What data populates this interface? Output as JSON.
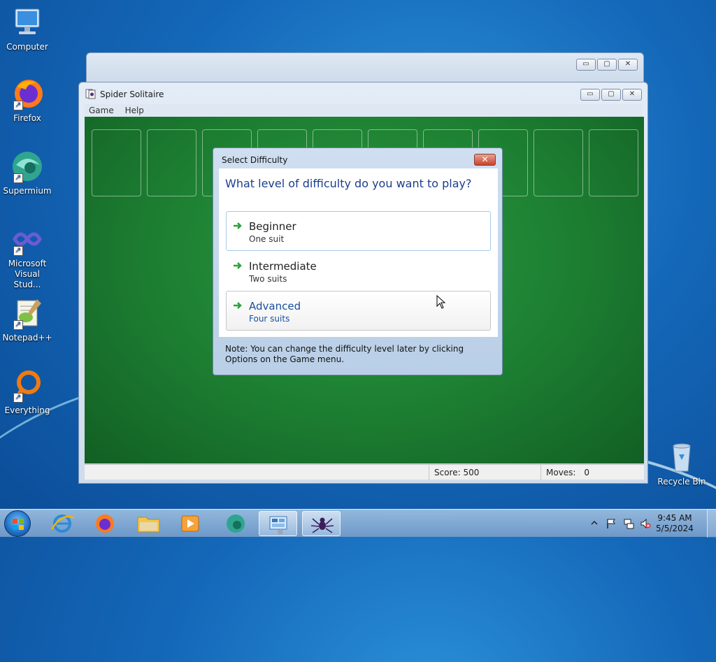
{
  "desktop": {
    "icons": [
      {
        "label": "Computer",
        "icon": "computer-icon"
      },
      {
        "label": "Firefox",
        "icon": "firefox-icon"
      },
      {
        "label": "Supermium",
        "icon": "supermium-icon"
      },
      {
        "label": "Microsoft Visual Stud...",
        "icon": "visual-studio-icon"
      },
      {
        "label": "Notepad++",
        "icon": "notepadpp-icon"
      },
      {
        "label": "Everything",
        "icon": "everything-icon"
      }
    ],
    "recycle_bin": {
      "label": "Recycle Bin",
      "icon": "recycle-bin-icon"
    }
  },
  "window": {
    "title": "Spider Solitaire",
    "menu": [
      "Game",
      "Help"
    ],
    "controls": {
      "minimize": "▭",
      "maximize": "▢",
      "close": "✕"
    },
    "status": {
      "score": "Score: 500",
      "moves_label": "Moves:",
      "moves_value": "0"
    },
    "tableau_slots": 10
  },
  "dialog": {
    "title": "Select Difficulty",
    "close": "✕",
    "question": "What level of difficulty do you want to play?",
    "options": [
      {
        "label": "Beginner",
        "sub": "One suit",
        "state": "selected"
      },
      {
        "label": "Intermediate",
        "sub": "Two suits",
        "state": "normal"
      },
      {
        "label": "Advanced",
        "sub": "Four suits",
        "state": "hover"
      }
    ],
    "note": "Note: You can change the difficulty level later by clicking Options on the Game menu."
  },
  "taskbar": {
    "items": [
      {
        "name": "internet-explorer-icon",
        "active": false
      },
      {
        "name": "firefox-icon",
        "active": false
      },
      {
        "name": "file-explorer-icon",
        "active": false
      },
      {
        "name": "media-player-icon",
        "active": false
      },
      {
        "name": "supermium-icon",
        "active": false
      },
      {
        "name": "control-panel-icon",
        "active": true
      },
      {
        "name": "spider-solitaire-icon",
        "active": true
      }
    ],
    "clock": {
      "time": "9:45 AM",
      "date": "5/5/2024"
    }
  },
  "colors": {
    "felt": "#1c7d31",
    "accent": "#1b3e8f",
    "link_hover": "#1a4fa0"
  }
}
